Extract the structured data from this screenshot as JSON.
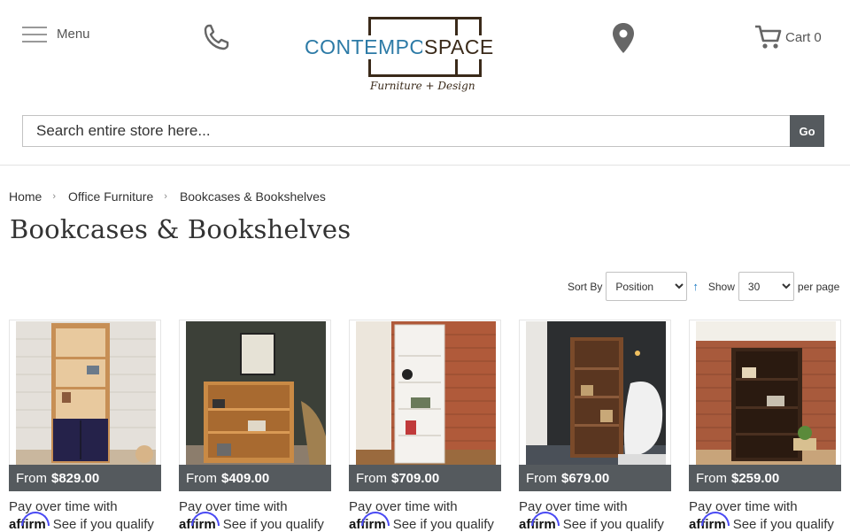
{
  "header": {
    "menu_label": "Menu",
    "cart_label": "Cart",
    "cart_count": "0",
    "logo": {
      "word1": "CONTEMPO",
      "word2": "SPACE",
      "tagline": "Furniture + Design"
    }
  },
  "search": {
    "placeholder": "Search entire store here...",
    "button_label": "Go"
  },
  "breadcrumbs": [
    {
      "label": "Home"
    },
    {
      "label": "Office Furniture"
    },
    {
      "label": "Bookcases & Bookshelves"
    }
  ],
  "page_title": "Bookcases & Bookshelves",
  "toolbar": {
    "sort_label": "Sort By",
    "sort_value": "Position",
    "sort_arrow": "↑",
    "show_label": "Show",
    "limit_value": "30",
    "per_page_label": "per page"
  },
  "products": [
    {
      "price_prefix": "From",
      "price": "$829.00",
      "affirm_text": "Pay over time with",
      "affirm_logo": "affirm",
      "affirm_cta": "See if you qualify"
    },
    {
      "price_prefix": "From",
      "price": "$409.00",
      "affirm_text": "Pay over time with",
      "affirm_logo": "affirm",
      "affirm_cta": "See if you qualify"
    },
    {
      "price_prefix": "From",
      "price": "$709.00",
      "affirm_text": "Pay over time with",
      "affirm_logo": "affirm",
      "affirm_cta": "See if you qualify"
    },
    {
      "price_prefix": "From",
      "price": "$679.00",
      "affirm_text": "Pay over time with",
      "affirm_logo": "affirm",
      "affirm_cta": "See if you qualify"
    },
    {
      "price_prefix": "From",
      "price": "$259.00",
      "affirm_text": "Pay over time with",
      "affirm_logo": "affirm",
      "affirm_cta": "See if you qualify"
    }
  ],
  "colors": {
    "brand_blue": "#2c7aa6",
    "brand_brown": "#3a2a1a",
    "price_bar": "#555a5e",
    "affirm_blue": "#4a4af4"
  },
  "icons": [
    "hamburger-icon",
    "phone-icon",
    "location-pin-icon",
    "cart-icon",
    "sort-arrow-icon"
  ]
}
